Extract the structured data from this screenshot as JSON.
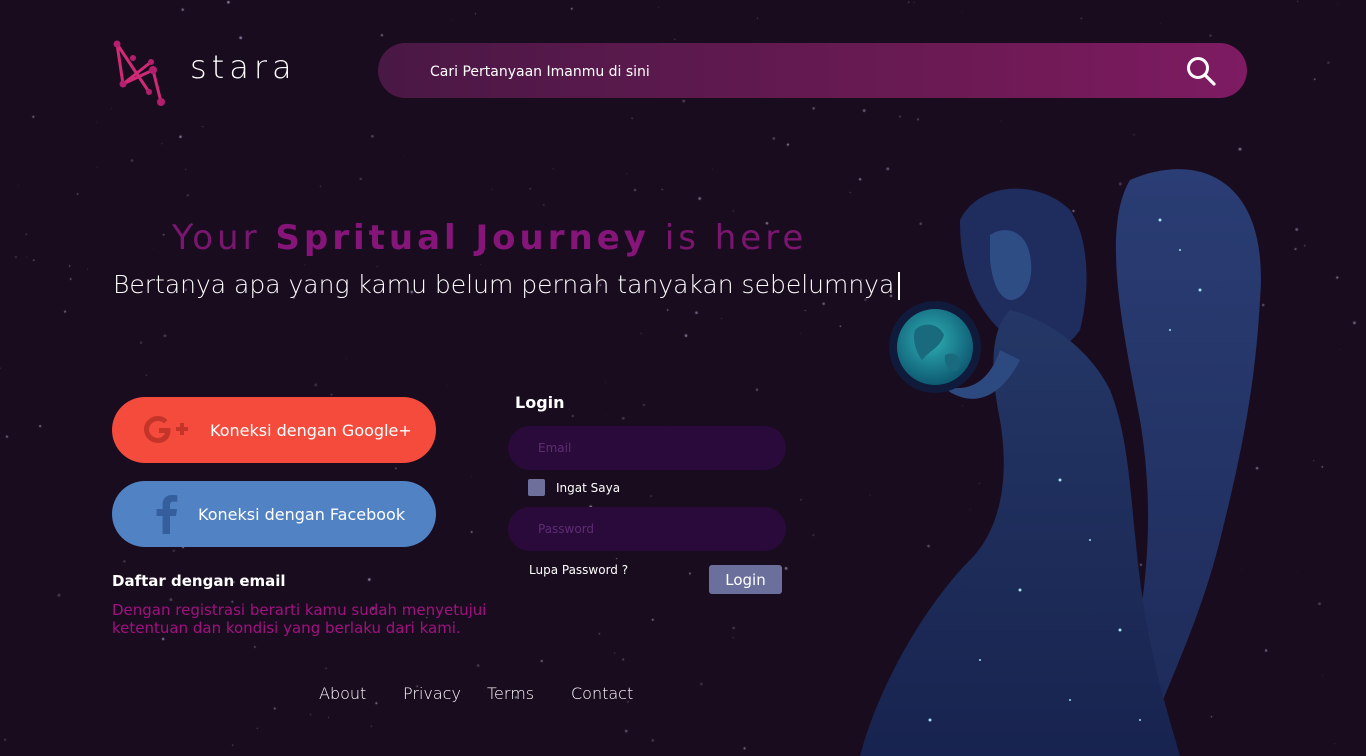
{
  "brand": {
    "name": "stara"
  },
  "search": {
    "placeholder": "Cari Pertanyaan Imanmu di sini"
  },
  "hero": {
    "title_part1": "Your ",
    "title_strong": "Spritual Journey",
    "title_part2": " is here",
    "subtitle": "Bertanya apa yang kamu belum pernah tanyakan sebelumnya"
  },
  "social": {
    "google_label": "Koneksi dengan Google+",
    "facebook_label": "Koneksi dengan Facebook"
  },
  "register": {
    "title": "Daftar dengan email",
    "note": "Dengan registrasi berarti kamu sudah menyetujui ketentuan dan kondisi yang berlaku dari kami."
  },
  "login": {
    "title": "Login",
    "email_placeholder": "Email",
    "remember_label": "Ingat Saya",
    "password_placeholder": "Password",
    "forgot_label": "Lupa Password ?",
    "button_label": "Login"
  },
  "footer": {
    "links": [
      "About",
      "Privacy",
      "Terms",
      "Contact"
    ]
  },
  "colors": {
    "background": "#1a0c1f",
    "accent": "#86157a",
    "google": "#f44b3c",
    "facebook": "#5082c4"
  },
  "icons": [
    "logo-constellation-icon",
    "search-icon",
    "google-plus-icon",
    "facebook-icon"
  ]
}
